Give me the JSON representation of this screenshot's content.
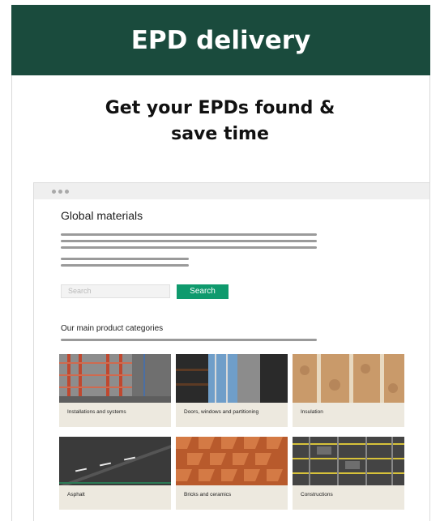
{
  "header": {
    "title": "EPD delivery"
  },
  "hero": {
    "line1": "Get your EPDs found &",
    "line2": "save time"
  },
  "browser": {
    "page_title": "Global materials",
    "search": {
      "placeholder": "Search",
      "button_label": "Search"
    },
    "section_title": "Our main product categories",
    "categories": [
      {
        "label": "Installations and systems"
      },
      {
        "label": "Doors, windows and partitioning"
      },
      {
        "label": "Insulation"
      },
      {
        "label": "Asphalt"
      },
      {
        "label": "Bricks and ceramics"
      },
      {
        "label": "Constructions"
      }
    ]
  },
  "colors": {
    "brand": "#1a4b3d",
    "accent": "#0f9a6d",
    "card_bg": "#ede9df"
  }
}
